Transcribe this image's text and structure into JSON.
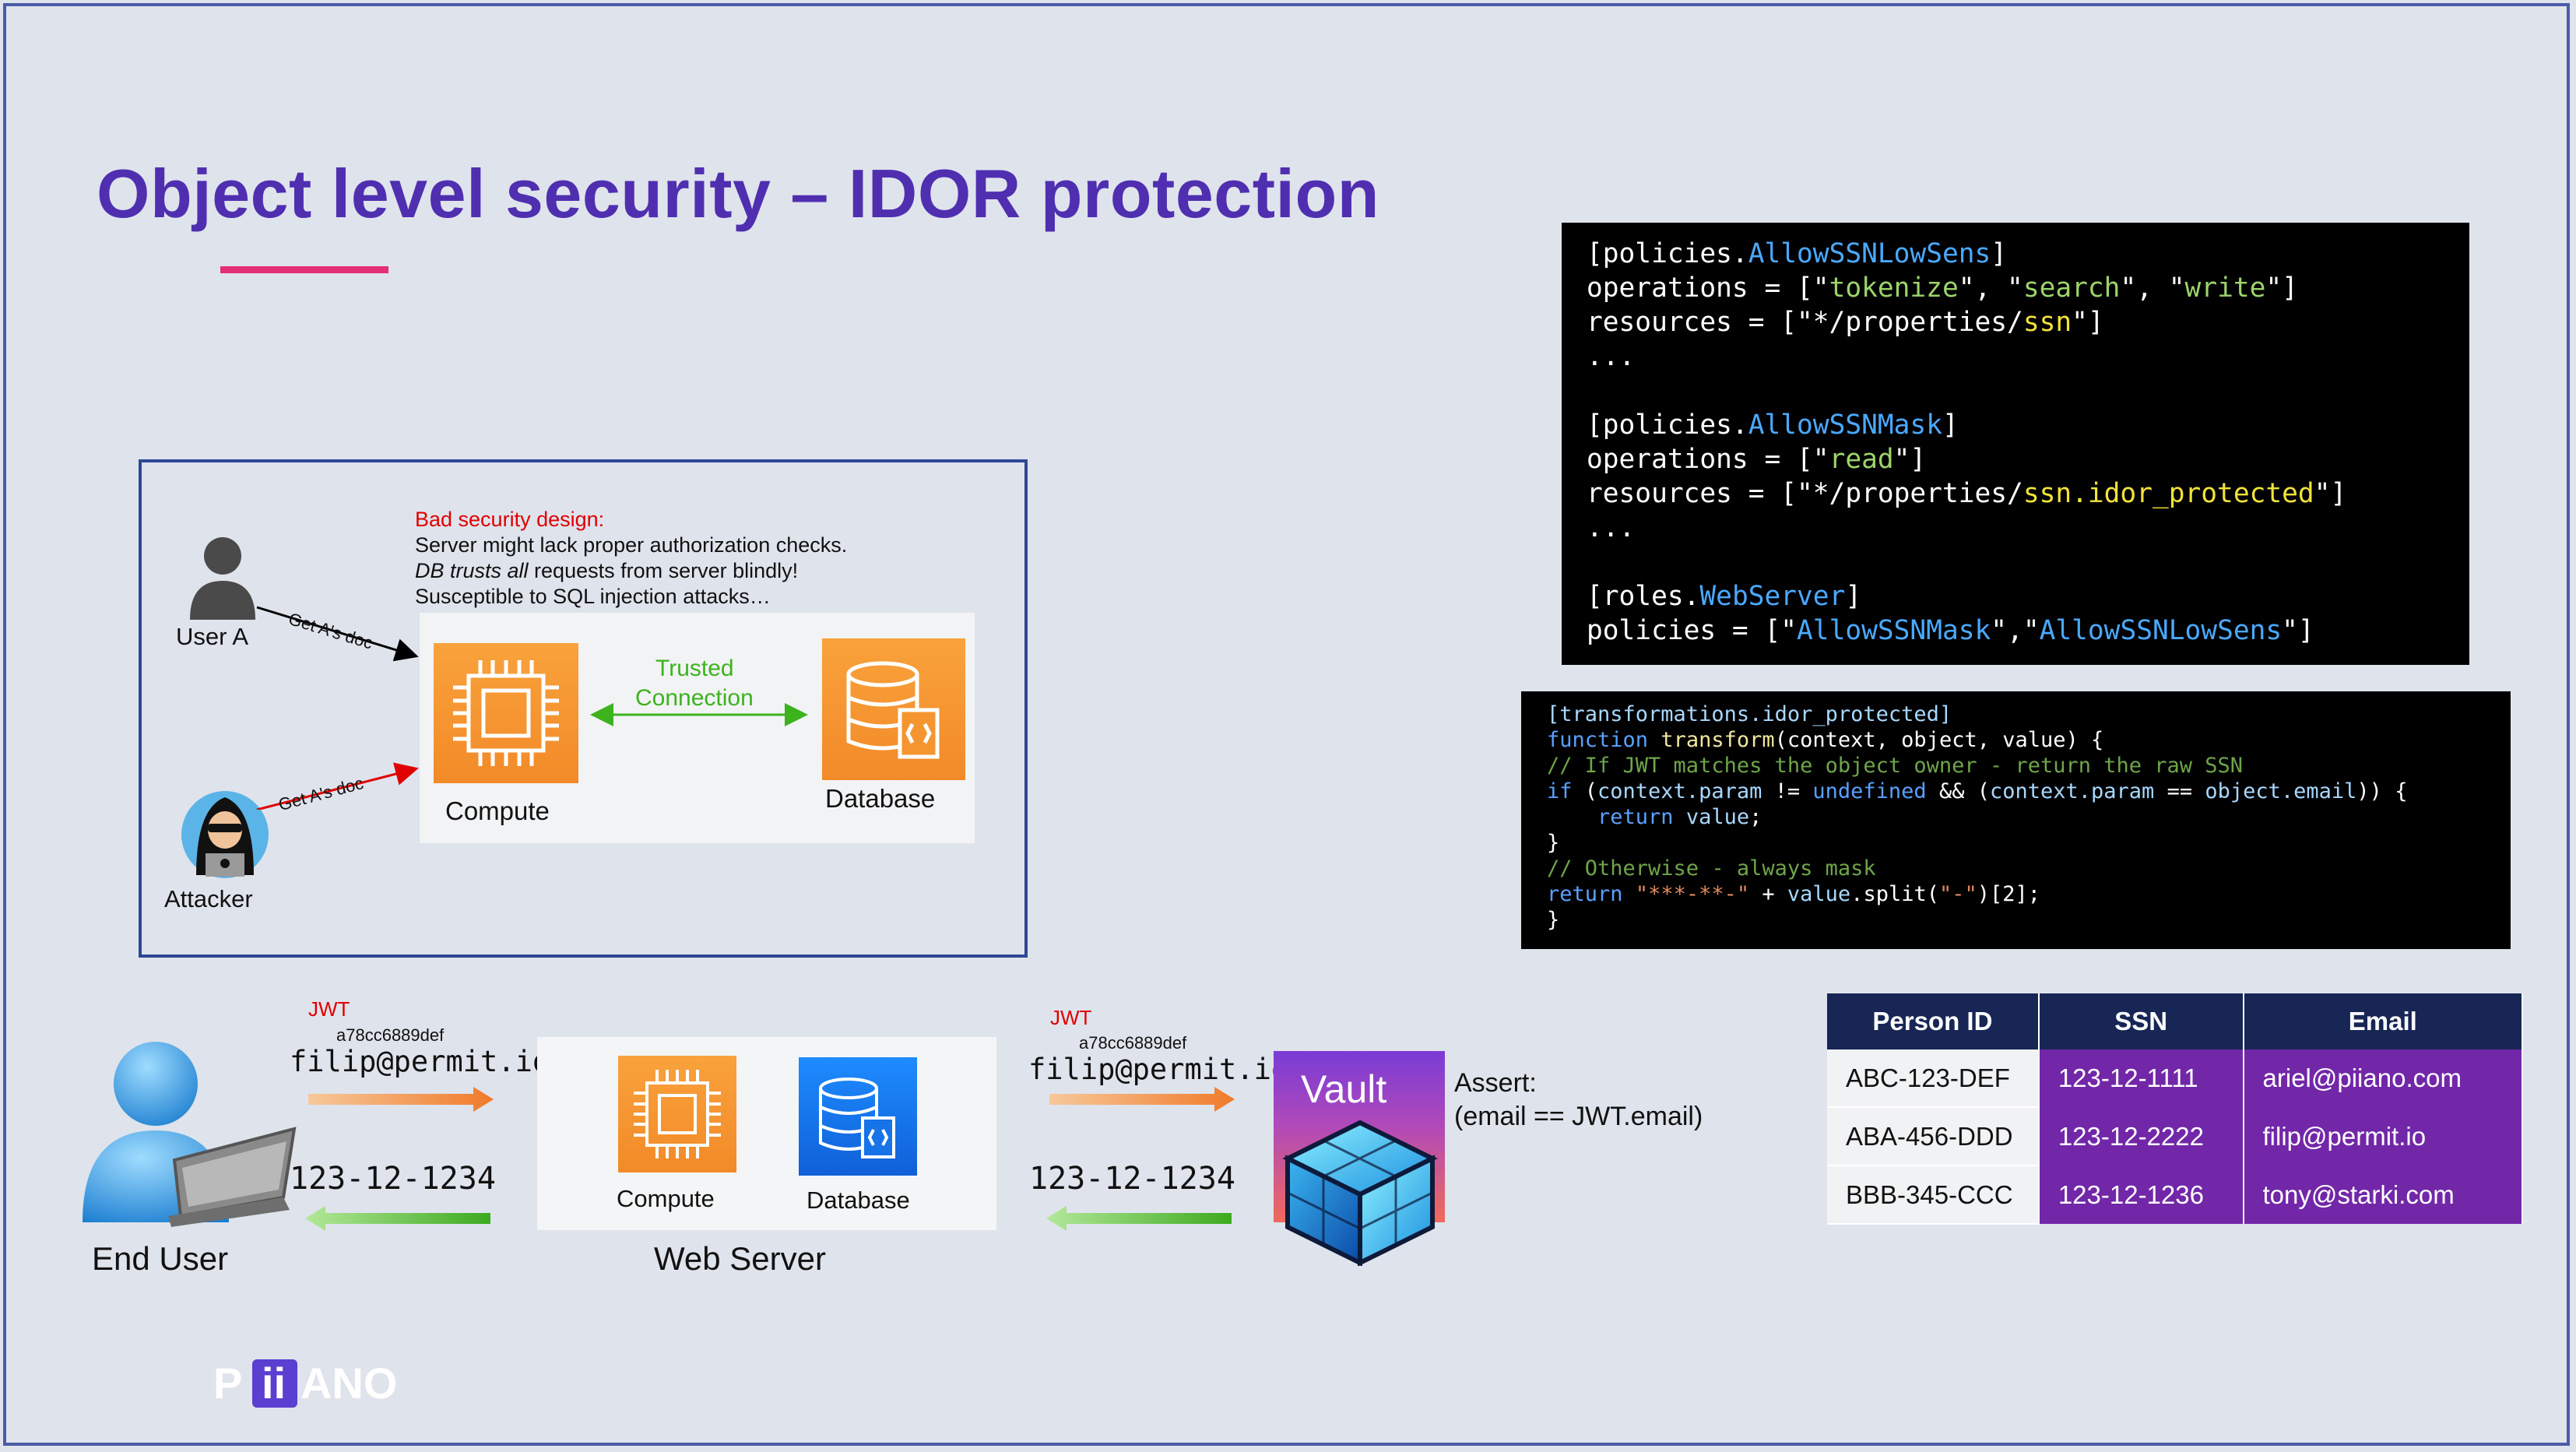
{
  "slide": {
    "title": "Object level security – IDOR protection",
    "accent_color": "#e32f76",
    "title_color": "#4f2fb0"
  },
  "policy_code": {
    "line1_open": "[policies.",
    "line1_name": "AllowSSNLowSens",
    "line1_close": "]",
    "line2_key": "operations = [\"",
    "line2_v1": "tokenize",
    "line2_sep1": "\", \"",
    "line2_v2": "search",
    "line2_sep2": "\", \"",
    "line2_v3": "write",
    "line2_end": "\"]",
    "line3_key": "resources = [\"*/properties/",
    "line3_v": "ssn",
    "line3_end": "\"]",
    "ellipsis1": "...",
    "line5_open": "[policies.",
    "line5_name": "AllowSSNMask",
    "line5_close": "]",
    "line6_key": "operations = [\"",
    "line6_v": "read",
    "line6_end": "\"]",
    "line7_key": "resources = [\"*/properties/",
    "line7_v": "ssn.idor_protected",
    "line7_end": "\"]",
    "ellipsis2": "...",
    "line9_open": "[roles.",
    "line9_name": "WebServer",
    "line9_close": "]",
    "line10_key": "policies = [\"",
    "line10_v1": "AllowSSNMask",
    "line10_sep": "\",\"",
    "line10_v2": "AllowSSNLowSens",
    "line10_end": "\"]"
  },
  "transform_code": {
    "l1": "[transformations.idor_protected]",
    "l2_kw": "function",
    "l2_fn": "transform",
    "l2_args": "(context, object, value) {",
    "l3": "// If JWT matches the object owner - return the raw SSN",
    "l4_kw": "if",
    "l4_a": " (",
    "l4_b": "context.param",
    "l4_c": " != ",
    "l4_d": "undefined",
    "l4_e": " && (",
    "l4_f": "context.param",
    "l4_g": " == ",
    "l4_h": "object.email",
    "l4_i": ")) {",
    "l5_kw": "return",
    "l5_v": "value",
    "l5_end": ";",
    "l6": "}",
    "l7": "// Otherwise - always mask",
    "l8_kw": "return",
    "l8_str": "\"***-**-\"",
    "l8_plus": " + ",
    "l8_v": "value",
    "l8_rest": ".split(",
    "l8_str2": "\"-\"",
    "l8_end": ")[2];",
    "l9": "}"
  },
  "bad_design": {
    "heading": "Bad security design:",
    "line1": "Server might lack proper authorization checks.",
    "line2_em": "DB trusts all",
    "line2_rest": " requests from server blindly!",
    "line3": "Susceptible to SQL injection attacks…",
    "user_label": "User A",
    "attacker_label": "Attacker",
    "user_arrow": "Get A's doc",
    "attacker_arrow": "Get A's doc",
    "compute_label": "Compute",
    "database_label": "Database",
    "trusted_line1": "Trusted",
    "trusted_line2": "Connection"
  },
  "flow": {
    "end_user_label": "End User",
    "web_server_label": "Web Server",
    "compute_label": "Compute",
    "database_label": "Database",
    "jwt_label_1": "JWT",
    "jwt_value_1": "a78cc6889def",
    "email_1": "filip@permit.io",
    "ssn_1": "123-12-1234",
    "jwt_label_2": "JWT",
    "jwt_value_2": "a78cc6889def",
    "email_2": "filip@permit.io",
    "ssn_2": "123-12-1234",
    "vault_label": "Vault",
    "assert_line1": "Assert:",
    "assert_line2": "(email == JWT.email)"
  },
  "table": {
    "headers": [
      "Person ID",
      "SSN",
      "Email"
    ],
    "rows": [
      [
        "ABC-123-DEF",
        "123-12-1111",
        "ariel@piiano.com"
      ],
      [
        "ABA-456-DDD",
        "123-12-2222",
        "filip@permit.io"
      ],
      [
        "BBB-345-CCC",
        "123-12-1236",
        "tony@starki.com"
      ]
    ]
  },
  "logo": {
    "text": "PIIANO"
  }
}
